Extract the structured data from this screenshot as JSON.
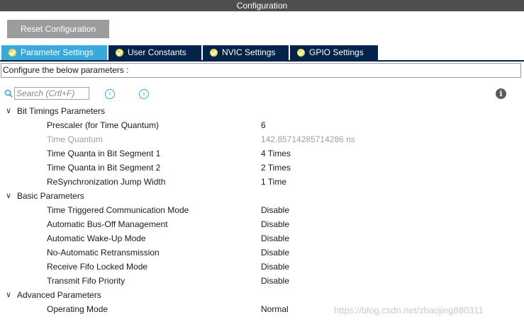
{
  "window": {
    "title": "Configuration"
  },
  "toolbar": {
    "reset_label": "Reset Configuration"
  },
  "tabs": [
    {
      "label": "Parameter Settings",
      "active": true
    },
    {
      "label": "User Constants",
      "active": false
    },
    {
      "label": "NVIC Settings",
      "active": false
    },
    {
      "label": "GPIO Settings",
      "active": false
    }
  ],
  "description": "Configure the below parameters :",
  "search": {
    "placeholder": "Search (Crtl+F)",
    "prev_icon": "chevron-left-circle-icon",
    "next_icon": "chevron-right-circle-icon"
  },
  "groups": [
    {
      "label": "Bit Timings Parameters",
      "params": [
        {
          "name": "Prescaler (for Time Quantum)",
          "value": "6"
        },
        {
          "name": "Time Quantum",
          "value": "142.85714285714286 ns",
          "disabled": true
        },
        {
          "name": "Time Quanta in Bit Segment 1",
          "value": "4 Times"
        },
        {
          "name": "Time Quanta in Bit Segment 2",
          "value": "2 Times"
        },
        {
          "name": "ReSynchronization Jump Width",
          "value": "1 Time"
        }
      ]
    },
    {
      "label": "Basic Parameters",
      "params": [
        {
          "name": "Time Triggered Communication Mode",
          "value": "Disable"
        },
        {
          "name": "Automatic Bus-Off Management",
          "value": "Disable"
        },
        {
          "name": "Automatic Wake-Up Mode",
          "value": "Disable"
        },
        {
          "name": "No-Automatic Retransmission",
          "value": "Disable"
        },
        {
          "name": "Receive Fifo Locked Mode",
          "value": "Disable"
        },
        {
          "name": "Transmit Fifo Priority",
          "value": "Disable"
        }
      ]
    },
    {
      "label": "Advanced Parameters",
      "params": [
        {
          "name": "Operating Mode",
          "value": "Normal"
        }
      ]
    }
  ],
  "watermark": "https://blog.csdn.net/zhaojing880311",
  "colors": {
    "titlebar": "#4f4f4f",
    "tab_active": "#39a9dc",
    "tab_inactive": "#03234b",
    "check_badge": "#e2e05c",
    "button": "#9c9c9c"
  }
}
